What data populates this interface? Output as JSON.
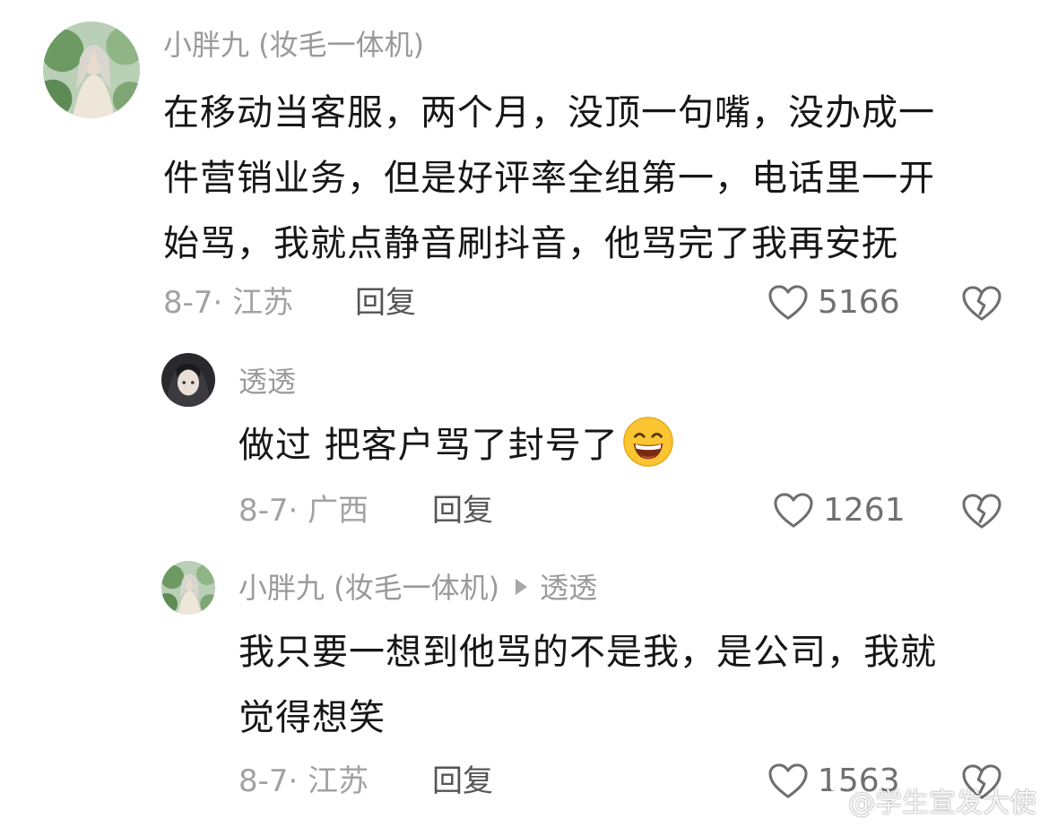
{
  "comments": [
    {
      "author": "小胖九 (妆毛一体机)",
      "lines": [
        "在移动当客服，两个月，没顶一句嘴，没办成一",
        "件营销业务，但是好评率全组第一，电话里一开",
        "始骂，我就点静音刷抖音，他骂完了我再安抚"
      ],
      "meta": "8-7· 江苏",
      "reply_label": "回复",
      "likes": "5166"
    },
    {
      "author": "透透",
      "lines": [
        "做过 把客户骂了封号了"
      ],
      "emoji": "grinning-sweat-emoji",
      "meta": "8-7· 广西",
      "reply_label": "回复",
      "likes": "1261"
    },
    {
      "author": "小胖九 (妆毛一体机)",
      "reply_to": "透透",
      "lines": [
        "我只要一想到他骂的不是我，是公司，我就",
        "觉得想笑"
      ],
      "meta": "8-7· 江苏",
      "reply_label": "回复",
      "likes": "1563"
    }
  ],
  "icons": {
    "like": "heart-outline-icon",
    "dislike": "broken-heart-icon",
    "reply_arrow": "triangle-right-icon",
    "watermark_logo": "weibo-logo-icon"
  },
  "watermark": {
    "text": "@学生宣发大使"
  }
}
